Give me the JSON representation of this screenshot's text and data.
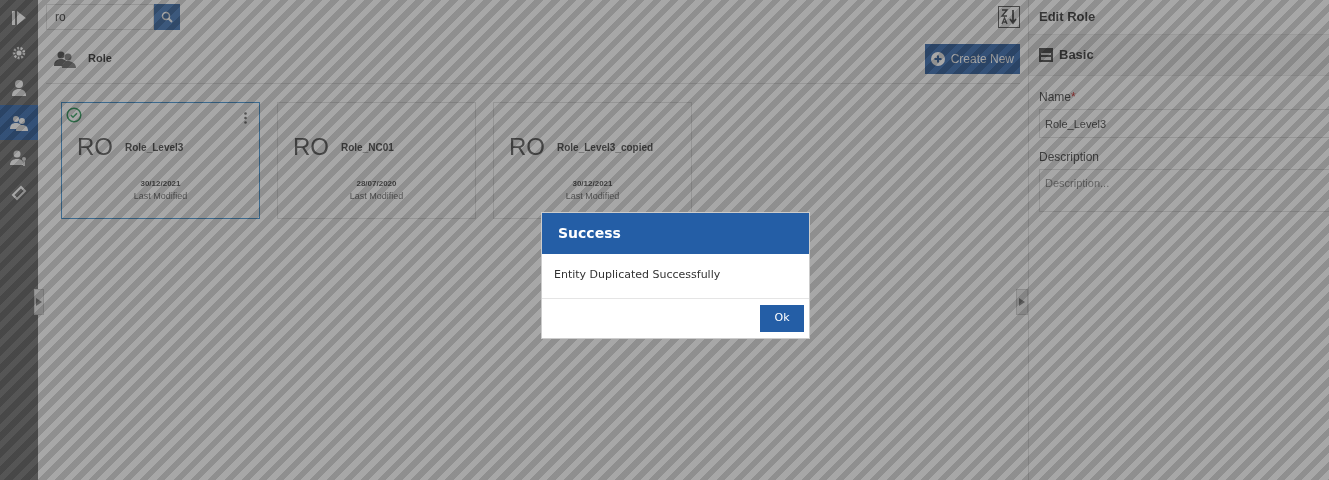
{
  "sidebar": {
    "items": [
      {
        "kind": "expand",
        "selected": false
      },
      {
        "kind": "gear",
        "selected": false
      },
      {
        "kind": "user",
        "selected": false
      },
      {
        "kind": "users",
        "selected": true
      },
      {
        "kind": "user-key",
        "selected": false
      },
      {
        "kind": "ticket",
        "selected": false
      }
    ]
  },
  "search": {
    "value": "ro"
  },
  "header": {
    "title": "Role",
    "create_button": "Create New"
  },
  "cards": [
    {
      "initials": "RO",
      "name": "Role_Level3",
      "date": "30/12/2021",
      "date_label": "Last Modified",
      "selected": true
    },
    {
      "initials": "RO",
      "name": "Role_NC01",
      "date": "28/07/2020",
      "date_label": "Last Modified",
      "selected": false
    },
    {
      "initials": "RO",
      "name": "Role_Level3_copied",
      "date": "30/12/2021",
      "date_label": "Last Modified",
      "selected": false
    }
  ],
  "edit_panel": {
    "title": "Edit Role",
    "section": "Basic",
    "fields": [
      {
        "kind": "input",
        "label": "Name",
        "required_mark": "*",
        "value": "Role_Level3"
      },
      {
        "kind": "textarea",
        "label": "Description",
        "placeholder": "Description..."
      }
    ]
  },
  "dialog": {
    "title": "Success",
    "message": "Entity Duplicated Successfully",
    "button": "Ok"
  }
}
